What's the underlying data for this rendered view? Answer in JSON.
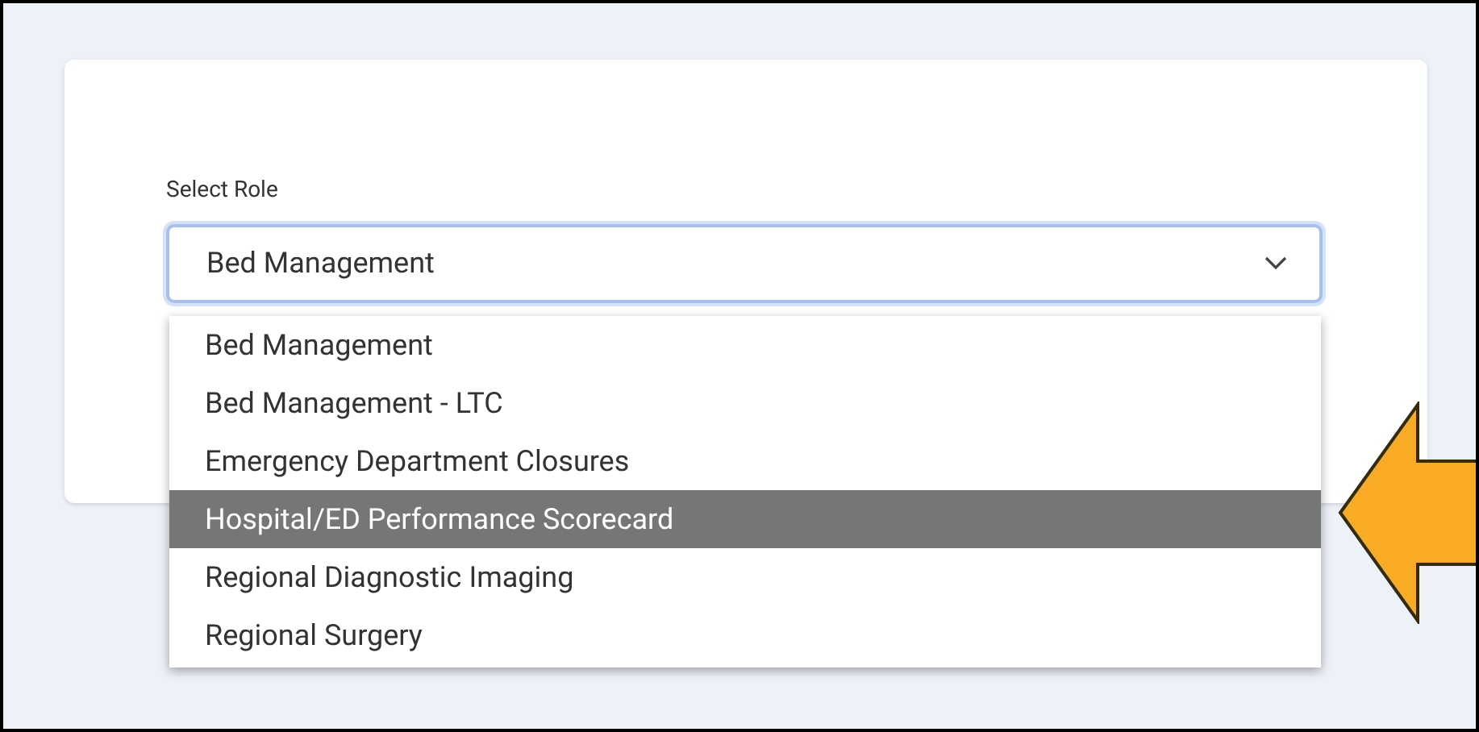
{
  "form": {
    "label": "Select Role",
    "select": {
      "value": "Bed Management",
      "expanded": true
    },
    "options": [
      {
        "label": "Bed Management",
        "selected": false
      },
      {
        "label": "Bed Management - LTC",
        "selected": false
      },
      {
        "label": "Emergency Department Closures",
        "selected": false
      },
      {
        "label": "Hospital/ED Performance Scorecard",
        "selected": true
      },
      {
        "label": "Regional Diagnostic Imaging",
        "selected": false
      },
      {
        "label": "Regional Surgery",
        "selected": false
      }
    ]
  }
}
